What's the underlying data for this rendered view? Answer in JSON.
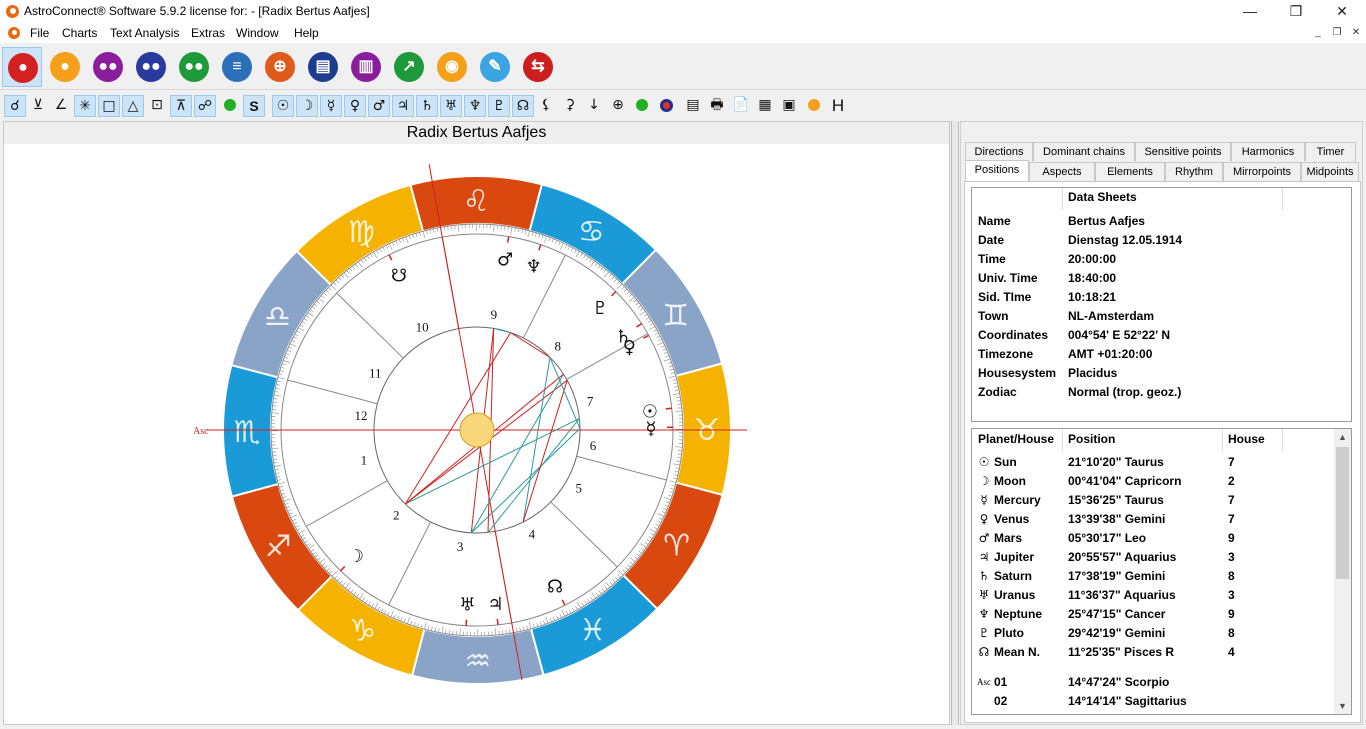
{
  "window": {
    "title": "AstroConnect® Software 5.9.2   license for:   - [Radix Bertus Aafjes]",
    "minimize": "—",
    "restore": "❐",
    "close": "✕"
  },
  "menu": {
    "items": [
      "File",
      "Charts",
      "Text Analysis",
      "Extras",
      "Window",
      "Help"
    ]
  },
  "big_toolbar": {
    "buttons": [
      {
        "icon": "person-icon",
        "color": "#d42020"
      },
      {
        "icon": "person-icon",
        "color": "#f5a01a"
      },
      {
        "icon": "people-icon",
        "color": "#8a1d9b"
      },
      {
        "icon": "people-icon",
        "color": "#2a3a9e"
      },
      {
        "icon": "people-icon",
        "color": "#1f9a3a"
      },
      {
        "icon": "list-icon",
        "color": "#2b6fb8"
      },
      {
        "icon": "globe-icon",
        "color": "#e05a1a"
      },
      {
        "icon": "id-card-icon",
        "color": "#1e3d8f"
      },
      {
        "icon": "book-icon",
        "color": "#8a1d9b"
      },
      {
        "icon": "trend-chart-icon",
        "color": "#1f9a3a"
      },
      {
        "icon": "podcast-icon",
        "color": "#f5a01a"
      },
      {
        "icon": "edit-icon",
        "color": "#3aa5e0"
      },
      {
        "icon": "exit-icon",
        "color": "#cc1e1e"
      }
    ]
  },
  "small_toolbar": {
    "buttons": [
      "☌",
      "⊻",
      "∠",
      "✳",
      "□",
      "△",
      "⊡",
      "⊼",
      "☍",
      "●",
      "S",
      "☉",
      "☽",
      "☿",
      "♀",
      "♂",
      "♃",
      "♄",
      "♅",
      "♆",
      "♇",
      "☊",
      "⚸",
      "⚳",
      "↓",
      "⊕",
      "●",
      "◎",
      "▤",
      "🖶",
      "📄",
      "▦",
      "▣",
      "●",
      "H"
    ],
    "dot_colors": {
      "green": "#22b022",
      "orange": "#f5a01a"
    }
  },
  "chart": {
    "title": "Radix Bertus Aafjes",
    "mc_label": "MC",
    "asc_label": "Asc",
    "house_numbers": [
      "1",
      "2",
      "3",
      "4",
      "5",
      "6",
      "7",
      "8",
      "9",
      "10",
      "11",
      "12"
    ],
    "planet_glyphs": {
      "mars": "♂",
      "neptune": "♆",
      "node": "☊",
      "pluto": "♇",
      "saturn": "♄",
      "venus": "♀",
      "sun": "☉",
      "mercury": "☿",
      "moon": "☽",
      "uranus": "♅",
      "jupiter": "♃",
      "south_node": "☋"
    },
    "sign_colors": {
      "fire": "#d9480f",
      "earth": "#f5b300",
      "air": "#8aa4c8",
      "water": "#1a9ad6"
    }
  },
  "tabs": {
    "row1": [
      "Directions",
      "Dominant chains",
      "Sensitive points",
      "Harmonics",
      "Timer"
    ],
    "row2": [
      "Positions",
      "Aspects",
      "Elements",
      "Rhythm",
      "Mirrorpoints",
      "Midpoints"
    ],
    "active": "Positions"
  },
  "datasheet": {
    "title": "Data Sheets",
    "rows": [
      {
        "key": "Name",
        "value": "Bertus Aafjes"
      },
      {
        "key": "Date",
        "value": "Dienstag 12.05.1914"
      },
      {
        "key": "Time",
        "value": "20:00:00"
      },
      {
        "key": "Univ. Time",
        "value": "18:40:00"
      },
      {
        "key": "Sid. TIme",
        "value": "10:18:21"
      },
      {
        "key": "Town",
        "value": "NL-Amsterdam"
      },
      {
        "key": "Coordinates",
        "value": "004°54' E 52°22' N"
      },
      {
        "key": "Timezone",
        "value": "AMT +01:20:00"
      },
      {
        "key": "Housesystem",
        "value": "Placidus"
      },
      {
        "key": "Zodiac",
        "value": "Normal (trop. geoz.)"
      }
    ]
  },
  "positions": {
    "headers": [
      "Planet/House",
      "Position",
      "House"
    ],
    "rows": [
      {
        "glyph": "☉",
        "name": "Sun",
        "position": "21°10'20\" Taurus",
        "house": "7"
      },
      {
        "glyph": "☽",
        "name": "Moon",
        "position": "00°41'04\" Capricorn",
        "house": "2"
      },
      {
        "glyph": "☿",
        "name": "Mercury",
        "position": "15°36'25\" Taurus",
        "house": "7"
      },
      {
        "glyph": "♀",
        "name": "Venus",
        "position": "13°39'38\" Gemini",
        "house": "7"
      },
      {
        "glyph": "♂",
        "name": "Mars",
        "position": "05°30'17\" Leo",
        "house": "9"
      },
      {
        "glyph": "♃",
        "name": "Jupiter",
        "position": "20°55'57\" Aquarius",
        "house": "3"
      },
      {
        "glyph": "♄",
        "name": "Saturn",
        "position": "17°38'19\" Gemini",
        "house": "8"
      },
      {
        "glyph": "♅",
        "name": "Uranus",
        "position": "11°36'37\" Aquarius",
        "house": "3"
      },
      {
        "glyph": "♆",
        "name": "Neptune",
        "position": "25°47'15\" Cancer",
        "house": "9"
      },
      {
        "glyph": "♇",
        "name": "Pluto",
        "position": "29°42'19\" Gemini",
        "house": "8"
      },
      {
        "glyph": "☊",
        "name": "Mean N.",
        "position": "11°25'35\" Pisces R",
        "house": "4"
      },
      {
        "glyph": "Asc",
        "name": "01",
        "position": "14°47'24\" Scorpio",
        "house": ""
      },
      {
        "glyph": "",
        "name": "02",
        "position": "14°14'14\" Sagittarius",
        "house": ""
      }
    ]
  }
}
